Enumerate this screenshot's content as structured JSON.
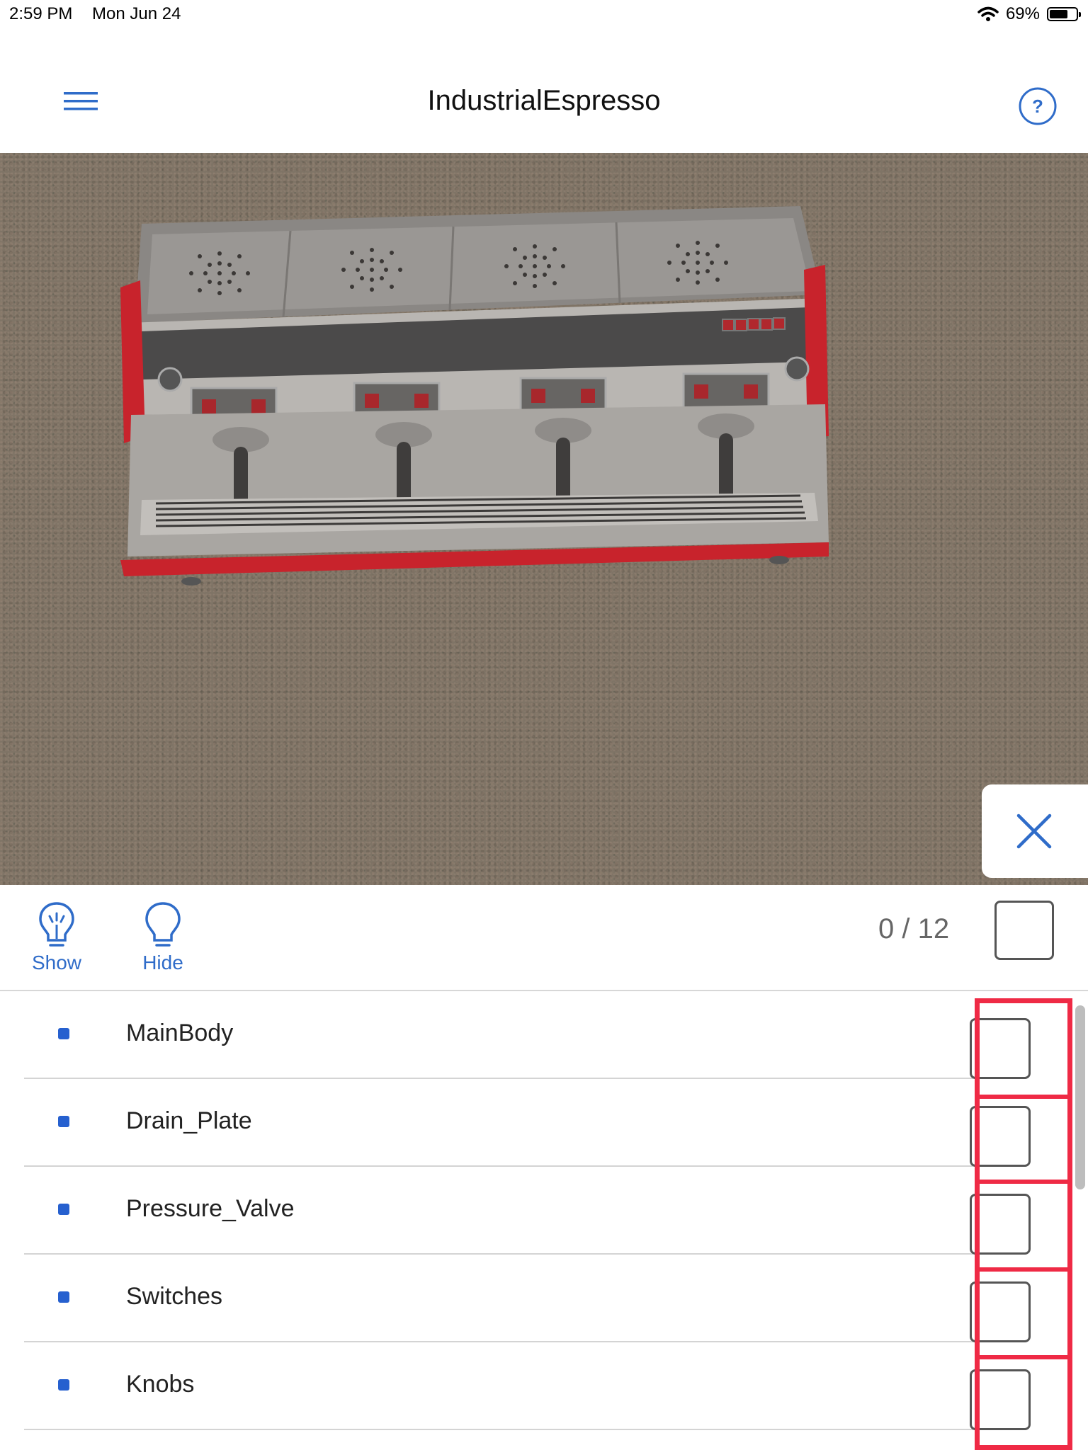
{
  "status_bar": {
    "time": "2:59 PM",
    "date": "Mon Jun 24",
    "battery": "69%",
    "battery_level": 0.69,
    "wifi_icon": "wifi-icon",
    "battery_icon": "battery-icon"
  },
  "nav": {
    "title": "IndustrialEspresso",
    "menu_icon": "hamburger-menu-icon",
    "help_icon": "help-question-icon",
    "help_glyph": "?"
  },
  "viewport": {
    "model": "espresso-machine-3d-model",
    "close_icon": "close-x-icon"
  },
  "toolbar": {
    "show_label": "Show",
    "hide_label": "Hide",
    "show_icon": "lightbulb-on-icon",
    "hide_icon": "lightbulb-off-icon",
    "counter": "0 / 12"
  },
  "list": {
    "items": [
      {
        "label": "MainBody",
        "checked": false
      },
      {
        "label": "Drain_Plate",
        "checked": false
      },
      {
        "label": "Pressure_Valve",
        "checked": false
      },
      {
        "label": "Switches",
        "checked": false
      },
      {
        "label": "Knobs",
        "checked": false
      }
    ]
  },
  "colors": {
    "accent": "#2f6cc9",
    "highlight": "#ef2a45",
    "machine_red": "#c8232c"
  }
}
